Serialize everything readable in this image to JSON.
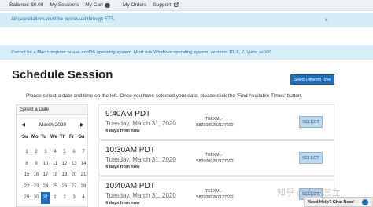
{
  "nav": {
    "balance": "Balance: $0.00",
    "sessions": "My Sessions",
    "cart": "My Cart",
    "cart_count": "0",
    "orders": "My Orders",
    "support": "Support"
  },
  "alert": {
    "text": "All cancellations must be processed through ETS.",
    "close": "×"
  },
  "warning": "Cannot be a Mac computer or use an iOS operating system. Must use Windows operating system, versions 10, 8, 7, Vista, or XP.",
  "page_title": "Schedule Session",
  "select_different_time": "Select Different Time",
  "instruction": "Please select a date and time on the left. Once you have selected your date, please click the 'Find Available Times' button.",
  "calendar": {
    "header": "Select a Date",
    "prev": "◀",
    "next": "▶",
    "month": "March 2020",
    "weekdays": [
      "Su",
      "Mo",
      "Tu",
      "We",
      "Th",
      "Fr",
      "Sa"
    ],
    "days": [
      "1",
      "2",
      "3",
      "4",
      "5",
      "6",
      "7",
      "8",
      "9",
      "10",
      "11",
      "12",
      "13",
      "14",
      "15",
      "16",
      "17",
      "18",
      "19",
      "20",
      "21",
      "22",
      "23",
      "24",
      "25",
      "26",
      "27",
      "28",
      "29",
      "30",
      "31",
      "1",
      "2",
      "3",
      "4"
    ],
    "selected": "31"
  },
  "slots": [
    {
      "time": "9:40AM PDT",
      "date": "Tuesday, March 31, 2020",
      "ahead": "4 days from now",
      "code1": "TELXML-",
      "code2": "S829009202127692",
      "button": "SELECT"
    },
    {
      "time": "10:30AM PDT",
      "date": "Tuesday, March 31, 2020",
      "ahead": "4 days from now",
      "code1": "TELXML-",
      "code2": "S829009202127692",
      "button": "SELECT"
    },
    {
      "time": "10:40AM PDT",
      "date": "Tuesday, March 31, 2020",
      "ahead": "4 days from now",
      "code1": "TELXML-",
      "code2": "S829009202127692",
      "button": "SELECT"
    }
  ],
  "help": "Need Help? Chat Now!",
  "watermark": "知乎 @无锡三立"
}
